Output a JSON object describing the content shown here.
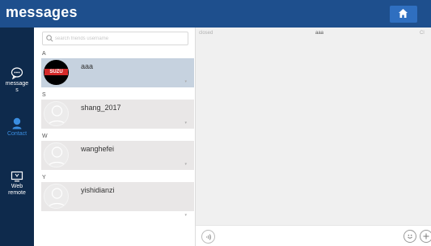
{
  "header": {
    "title": "messages",
    "home_icon": "home-icon"
  },
  "nav": {
    "items": [
      {
        "label_line1": "message",
        "label_line2": "s",
        "icon": "chat-bubble-icon",
        "active": false
      },
      {
        "label_line1": "Contact",
        "label_line2": "",
        "icon": "contact-person-icon",
        "active": true
      },
      {
        "label_line1": "Web",
        "label_line2": "remote",
        "icon": "web-remote-icon",
        "active": false
      }
    ]
  },
  "contacts": {
    "search_placeholder": "search friends username",
    "groups": [
      {
        "letter": "A",
        "name": "aaa",
        "avatar": "logo",
        "avatar_text": "SUZU",
        "selected": true
      },
      {
        "letter": "S",
        "name": "shang_2017",
        "avatar": "blank",
        "selected": false
      },
      {
        "letter": "W",
        "name": "wanghefei",
        "avatar": "blank",
        "selected": false
      },
      {
        "letter": "Y",
        "name": "yishidianzi",
        "avatar": "blank",
        "selected": false
      }
    ]
  },
  "chat": {
    "status": "closed",
    "contact_name": "aaa",
    "close_label": "Cl",
    "input_value": "",
    "voice_icon": "voice-icon",
    "emoji_icon": "emoji-icon",
    "add_icon": "plus-icon"
  },
  "colors": {
    "topbar": "#1e4f8d",
    "nav_bg": "#0e2a4c",
    "active_nav": "#3a8de0",
    "selected_row": "#c6d2df",
    "row_bg": "#e9e7e7",
    "chat_bg": "#f0f0f0"
  }
}
